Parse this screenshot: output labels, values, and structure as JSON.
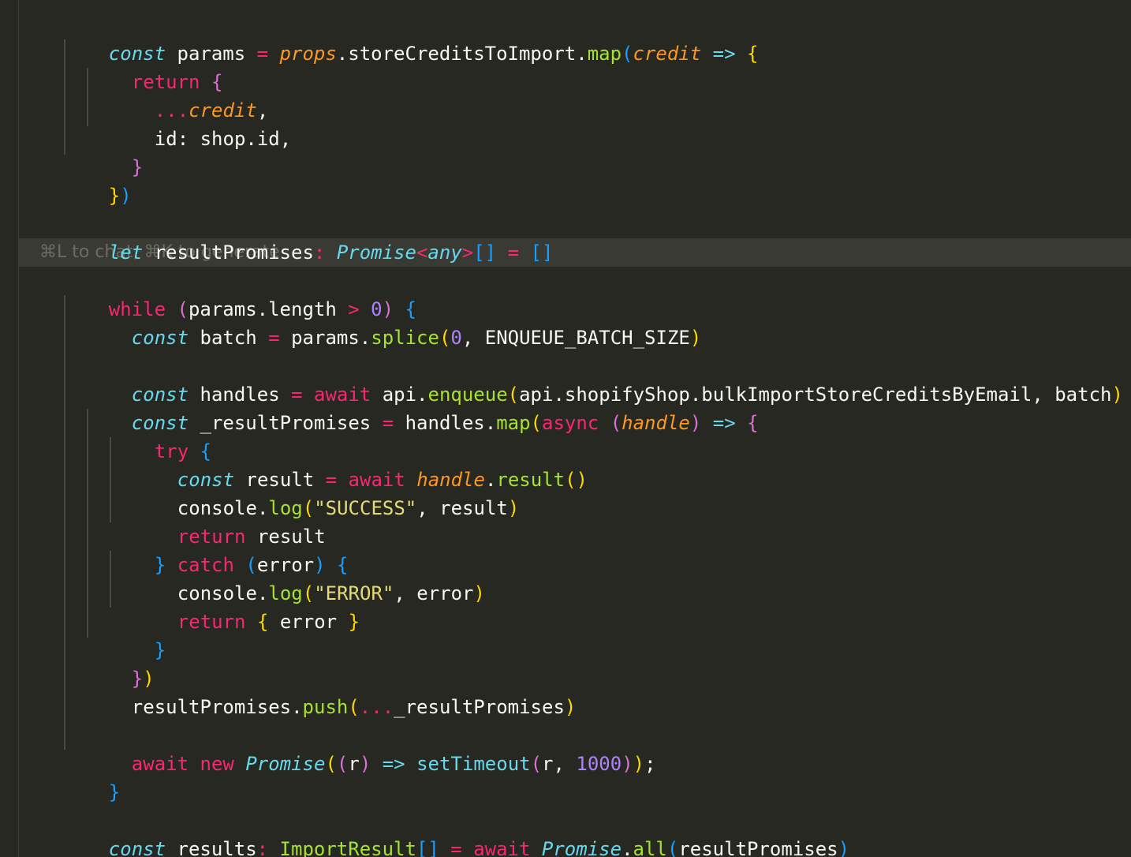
{
  "editor": {
    "inline_hint": "⌘L to chat, ⌘K to generate",
    "colors": {
      "background": "#272822",
      "keyword": "#f92672",
      "storage": "#66d9ef",
      "function": "#a6e22e",
      "parameter": "#fd971f",
      "number": "#ae81ff",
      "string": "#e6db74"
    },
    "lines": [
      [
        "const",
        " params ",
        "=",
        " ",
        "props",
        ".storeCreditsToImport.",
        "map",
        "(",
        "credit",
        " ",
        "=>",
        " ",
        "{"
      ],
      [
        "return",
        " ",
        "{"
      ],
      [
        "...",
        "credit",
        ","
      ],
      [
        "id: shop.id,"
      ],
      [
        "}"
      ],
      [
        "}",
        ")"
      ],
      [],
      [
        "let",
        " resultPromises",
        ":",
        " ",
        "Promise",
        "<",
        "any",
        ">",
        "[]",
        " ",
        "=",
        " ",
        "[]"
      ],
      [
        "while",
        " ",
        "(",
        "params.length ",
        ">",
        " ",
        "0",
        ")",
        " ",
        "{"
      ],
      [
        "const",
        " batch ",
        "=",
        " params.",
        "splice",
        "(",
        "0",
        ", ENQUEUE_BATCH_SIZE",
        ")"
      ],
      [],
      [
        "const",
        " handles ",
        "=",
        " ",
        "await",
        " api.",
        "enqueue",
        "(",
        "api.shopifyShop.bulkImportStoreCreditsByEmail, batch",
        ")"
      ],
      [
        "const",
        " _resultPromises ",
        "=",
        " handles.",
        "map",
        "(",
        "async",
        " ",
        "(",
        "handle",
        ")",
        " ",
        "=>",
        " ",
        "{"
      ],
      [
        "try",
        " ",
        "{"
      ],
      [
        "const",
        " result ",
        "=",
        " ",
        "await",
        " ",
        "handle",
        ".",
        "result",
        "()"
      ],
      [
        "console.",
        "log",
        "(",
        "\"SUCCESS\"",
        ", result",
        ")"
      ],
      [
        "return",
        " result"
      ],
      [
        "}",
        " ",
        "catch",
        " ",
        "(",
        "error",
        ")",
        " ",
        "{"
      ],
      [
        "console.",
        "log",
        "(",
        "\"ERROR\"",
        ", error",
        ")"
      ],
      [
        "return",
        " ",
        "{",
        " error ",
        "}"
      ],
      [
        "}"
      ],
      [
        "}",
        ")"
      ],
      [
        "resultPromises.",
        "push",
        "(",
        "...",
        "_resultPromises",
        ")"
      ],
      [],
      [
        "await",
        " ",
        "new",
        " ",
        "Promise",
        "(",
        "(",
        "r",
        ")",
        " ",
        "=>",
        " ",
        "setTimeout",
        "(",
        "r, ",
        "1000",
        ")",
        ")",
        ";"
      ],
      [
        "}"
      ],
      [],
      [
        "const",
        " results",
        ":",
        " ",
        "ImportResult",
        "[]",
        " ",
        "=",
        " ",
        "await",
        " ",
        "Promise",
        ".",
        "all",
        "(",
        "resultPromises",
        ")"
      ]
    ]
  }
}
